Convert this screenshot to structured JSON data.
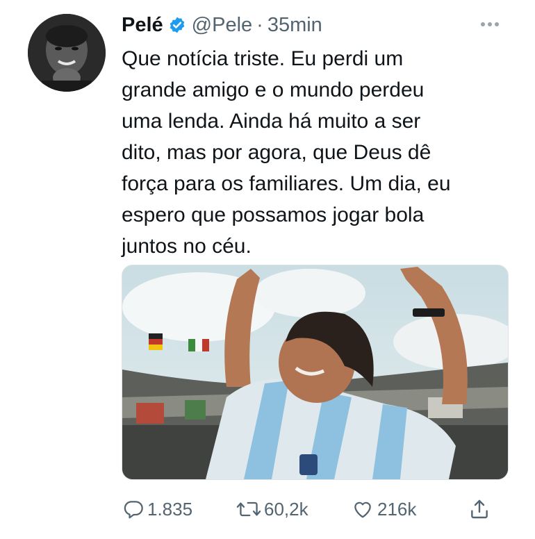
{
  "author": {
    "name": "Pelé",
    "handle": "@Pele",
    "separator": "·",
    "time": "35min",
    "verified": true
  },
  "tweet": {
    "text": "Que notícia triste. Eu perdi um\ngrande amigo e o mundo perdeu\numa lenda. Ainda há muito a ser\ndito, mas por agora, que Deus dê\nforça para os familiares. Um dia, eu\nespero que possamos jogar bola\njuntos no céu."
  },
  "icons": {
    "verified": "verified-badge-icon",
    "more": "more-options-icon",
    "reply": "reply-icon",
    "retweet": "retweet-icon",
    "like": "like-icon",
    "share": "share-icon"
  },
  "metrics": {
    "replies": "1.835",
    "retweets": "60,2k",
    "likes": "216k"
  },
  "colors": {
    "verified_blue": "#1d9bf0",
    "text_primary": "#0f1419",
    "text_secondary": "#536471"
  }
}
